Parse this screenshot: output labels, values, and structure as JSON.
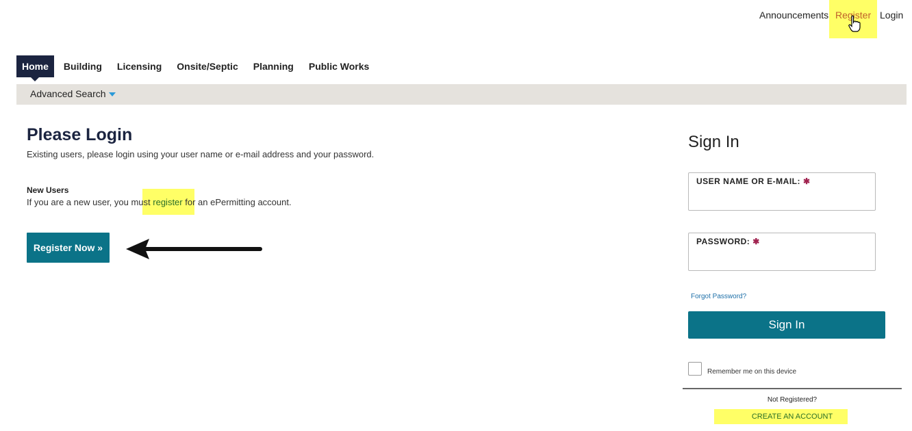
{
  "toplinks": {
    "announcements": "Announcements",
    "register": "Register",
    "login": "Login"
  },
  "nav": {
    "tabs": [
      "Home",
      "Building",
      "Licensing",
      "Onsite/Septic",
      "Planning",
      "Public Works"
    ],
    "active_index": 0,
    "advanced_search": "Advanced Search"
  },
  "main": {
    "title": "Please Login",
    "intro": "Existing users, please login using your user name or e-mail address and your password.",
    "new_users_heading": "New Users",
    "new_users_prefix": "If you are a new user, you must ",
    "new_users_link": "register",
    "new_users_suffix": " for an ePermitting account.",
    "register_now_button": "Register Now »"
  },
  "signin": {
    "title": "Sign In",
    "username_label": "USER NAME OR E-MAIL:",
    "password_label": "PASSWORD:",
    "required_mark": "✱",
    "username_value": "",
    "password_value": "",
    "forgot_password": "Forgot Password?",
    "signin_button": "Sign In",
    "remember_me": "Remember me on this device",
    "remember_checked": false,
    "not_registered": "Not Registered?",
    "create_account": "CREATE AN ACCOUNT"
  },
  "colors": {
    "primary_teal": "#0b7388",
    "nav_active": "#1b2440",
    "highlight": "#ffff66",
    "subbar": "#e5e2dd",
    "required": "#a0224f",
    "link_green": "#2a6f27"
  },
  "icons": {
    "pointer": "hand-pointer-icon",
    "arrow": "left-arrow-icon",
    "dropdown": "caret-down-icon"
  }
}
